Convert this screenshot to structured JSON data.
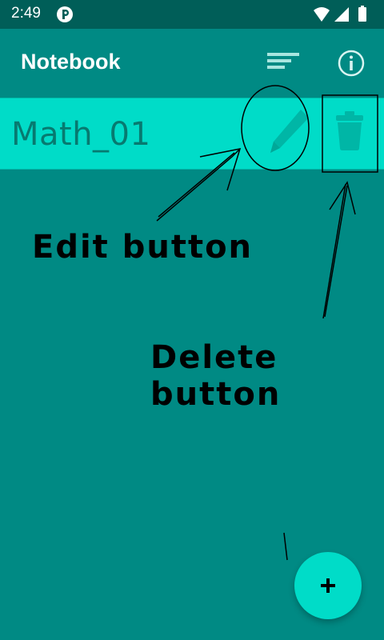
{
  "status_bar": {
    "time": "2:49"
  },
  "app_bar": {
    "title": "Notebook"
  },
  "notes": [
    {
      "title": "Math_01"
    }
  ],
  "annotations": {
    "edit_label": "Edit button",
    "delete_label": "Delete button"
  },
  "colors": {
    "background": "#008A84",
    "status_bar": "#005E58",
    "accent": "#00DCC8"
  },
  "icons": {
    "status": [
      "app-notification-icon",
      "wifi-icon",
      "signal-icon",
      "battery-icon"
    ],
    "toolbar": [
      "sort-icon",
      "info-icon"
    ],
    "row": [
      "pencil-icon",
      "trash-icon"
    ],
    "fab": "plus-icon"
  }
}
